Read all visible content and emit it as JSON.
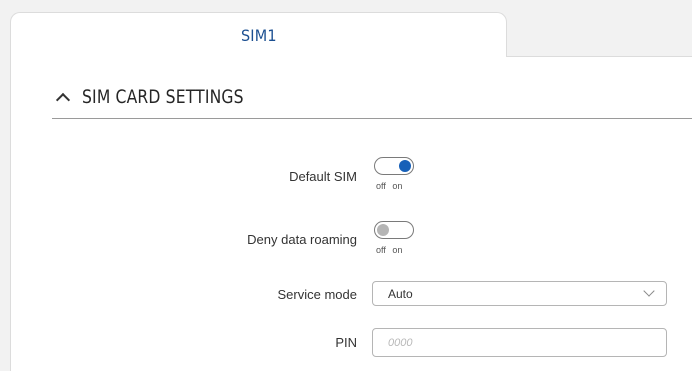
{
  "tabs": [
    {
      "label": "SIM1",
      "active": true
    }
  ],
  "section": {
    "title": "SIM CARD SETTINGS",
    "expanded": true
  },
  "fields": {
    "default_sim": {
      "label": "Default SIM",
      "state": "on",
      "caption": "off on"
    },
    "deny_data_roaming": {
      "label": "Deny data roaming",
      "state": "off",
      "caption": "off on"
    },
    "service_mode": {
      "label": "Service mode",
      "value": "Auto"
    },
    "pin": {
      "label": "PIN",
      "placeholder": "0000",
      "value": ""
    }
  },
  "colors": {
    "accent": "#1760b8",
    "tab_text": "#1b4f91",
    "toggle_off": "#b5b5b5"
  }
}
